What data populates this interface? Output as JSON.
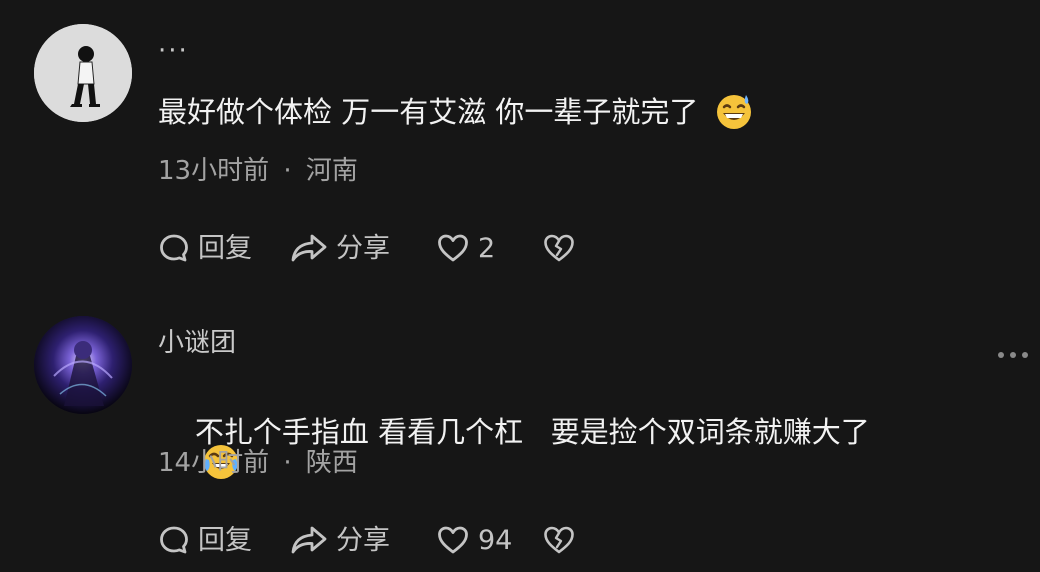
{
  "comments": [
    {
      "username": "···",
      "text": "最好做个体检 万一有艾滋 你一辈子就完了",
      "emoji": "grinning-sweat-emoji",
      "time": "13小时前",
      "separator": "·",
      "location": "河南",
      "reply_label": "回复",
      "share_label": "分享",
      "like_count": "2"
    },
    {
      "username": "小谜团",
      "text": "不扎个手指血 看看几个杠   要是捡个双词条就赚大了",
      "emoji": "crying-laughing-emoji",
      "time": "14小时前",
      "separator": "·",
      "location": "陕西",
      "reply_label": "回复",
      "share_label": "分享",
      "like_count": "94"
    }
  ],
  "colors": {
    "background": "#161616",
    "primary_text": "#f2f2f2",
    "secondary_text": "#a3a3a3",
    "icon": "#c4c4c4",
    "emoji_yellow": "#f5c33b"
  }
}
